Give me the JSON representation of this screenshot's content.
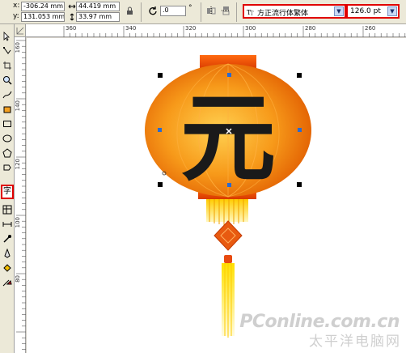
{
  "property_bar": {
    "x_label": "x:",
    "x_value": "-306.24 mm",
    "y_label": "y:",
    "y_value": "131.053 mm",
    "width_value": "44.419 mm",
    "height_value": "33.97 mm",
    "rotation_value": ".0",
    "degree_symbol": "°",
    "font_name": "方正流行体繁体",
    "font_size": "126.0 pt"
  },
  "ruler": {
    "horizontal_ticks": [
      "360",
      "340",
      "320",
      "300",
      "280",
      "260"
    ],
    "vertical_ticks": [
      "160",
      "140",
      "120",
      "100",
      "80"
    ]
  },
  "artwork": {
    "character": "元",
    "lantern_color": "#f07a10",
    "lantern_dark": "#e04a00",
    "tassel_color": "#ffd400"
  },
  "watermark": {
    "brand": "PConline.com.cn",
    "chinese": "太平洋电脑网"
  }
}
